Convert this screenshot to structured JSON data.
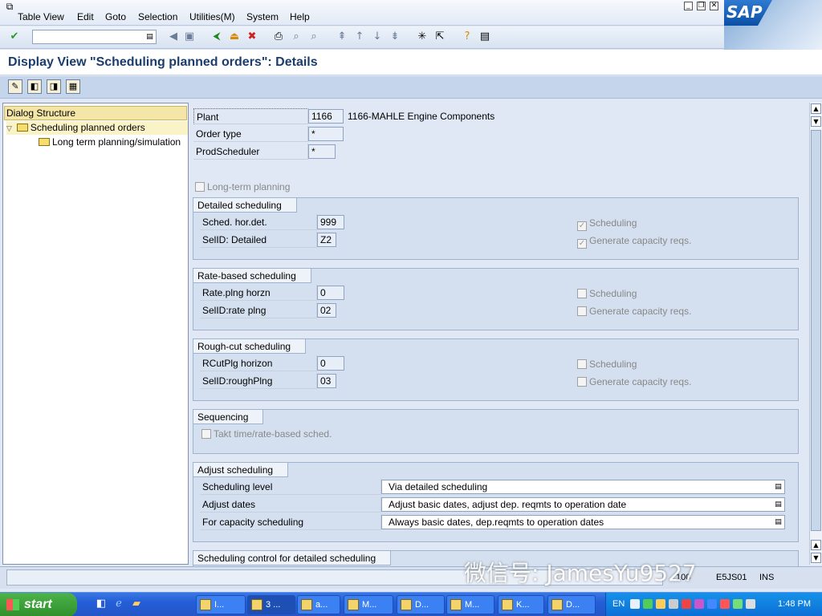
{
  "menu": {
    "items": [
      "Table View",
      "Edit",
      "Goto",
      "Selection",
      "Utilities(M)",
      "System",
      "Help"
    ]
  },
  "logo": {
    "text": "SAP"
  },
  "page": {
    "title": "Display View \"Scheduling planned orders\": Details"
  },
  "tree": {
    "header": "Dialog Structure",
    "items": [
      {
        "label": "Scheduling planned orders",
        "selected": true
      },
      {
        "label": "Long term planning/simulation",
        "selected": false
      }
    ]
  },
  "keys": {
    "plant_label": "Plant",
    "plant_value": "1166",
    "plant_desc": "1166-MAHLE Engine Components",
    "order_type_label": "Order type",
    "order_type_value": "*",
    "prodscheduler_label": "ProdScheduler",
    "prodscheduler_value": "*"
  },
  "long_term": {
    "label": "Long-term planning",
    "checked": false
  },
  "detailed": {
    "title": "Detailed scheduling",
    "horizon_label": "Sched. hor.det.",
    "horizon_value": "999",
    "selid_label": "SelID: Detailed",
    "selid_value": "Z2",
    "scheduling_label": "Scheduling",
    "scheduling_checked": true,
    "capacity_label": "Generate capacity reqs.",
    "capacity_checked": true
  },
  "rate": {
    "title": "Rate-based scheduling",
    "horizon_label": "Rate.plng horzn",
    "horizon_value": "0",
    "selid_label": "SelID:rate plng",
    "selid_value": "02",
    "scheduling_label": "Scheduling",
    "scheduling_checked": false,
    "capacity_label": "Generate capacity reqs.",
    "capacity_checked": false
  },
  "rough": {
    "title": "Rough-cut scheduling",
    "horizon_label": "RCutPlg horizon",
    "horizon_value": "0",
    "selid_label": "SelID:roughPlng",
    "selid_value": "03",
    "scheduling_label": "Scheduling",
    "scheduling_checked": false,
    "capacity_label": "Generate capacity reqs.",
    "capacity_checked": false
  },
  "sequencing": {
    "title": "Sequencing",
    "takt_label": "Takt time/rate-based sched.",
    "takt_checked": false
  },
  "adjust": {
    "title": "Adjust scheduling",
    "level_label": "Scheduling level",
    "level_value": "Via detailed scheduling",
    "dates_label": "Adjust dates",
    "dates_value": "Adjust basic dates, adjust dep. reqmts to operation date",
    "capacity_label": "For capacity scheduling",
    "capacity_value": "Always basic dates, dep.reqmts to operation dates"
  },
  "control": {
    "title": "Scheduling control for detailed scheduling"
  },
  "status": {
    "client": "100",
    "server": "E5JS01",
    "mode": "INS"
  },
  "watermark": {
    "text": "微信号: JamesYu9527"
  },
  "taskbar": {
    "start": "start",
    "tasks": [
      "I...",
      "3 ...",
      "a...",
      "M...",
      "D...",
      "M...",
      "K...",
      "D..."
    ],
    "lang": "EN",
    "clock": "1:48 PM"
  },
  "colors": {
    "title": "#1a3d6d",
    "tree_header": "#f4e6a6",
    "taskbar": "#245ed8",
    "start": "#2f8f2c"
  }
}
